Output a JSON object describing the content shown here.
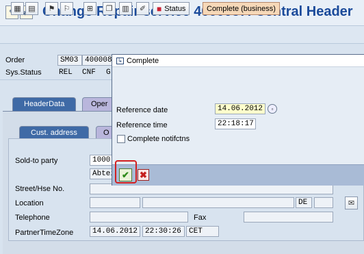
{
  "window": {
    "title": "Change Repair service 4000087: Central Header"
  },
  "toolbar": {
    "icons": [
      "calculator-icon",
      "overview-icon",
      "flag-check-icon",
      "flag-icon",
      "org-structure-icon",
      "copy-icon",
      "document-icon",
      "edit-icon",
      "truck-icon"
    ],
    "status_label": "Status",
    "complete_label": "Complete (business)"
  },
  "header": {
    "order_label": "Order",
    "order_type": "SM03",
    "order_number": "400008",
    "sys_status_label": "Sys.Status",
    "sys_status": [
      "REL",
      "CNF",
      "G"
    ]
  },
  "tabs": {
    "header_data": "HeaderData",
    "operations": "Oper"
  },
  "subtabs": {
    "cust_address": "Cust. address",
    "other": "O"
  },
  "address_form": {
    "sold_to_label": "Sold-to party",
    "sold_to_value": "1000",
    "dept_value": "Abtei",
    "street_label": "Street/Hse No.",
    "location_label": "Location",
    "country_value": "DE",
    "telephone_label": "Telephone",
    "fax_label": "Fax",
    "tz_label": "PartnerTimeZone",
    "tz_date": "14.06.2012",
    "tz_time": "22:30:26",
    "tz_zone": "CET"
  },
  "popup": {
    "title": "Complete",
    "ref_date_label": "Reference date",
    "ref_date_value": "14.06.2012",
    "ref_time_label": "Reference time",
    "ref_time_value": "22:18:17",
    "complete_notif_label": "Complete notifctns",
    "complete_notif_checked": false
  },
  "colors": {
    "title_blue": "#1a4a9a",
    "active_tab": "#3f6aa6",
    "highlight_red": "#d21f1f"
  }
}
